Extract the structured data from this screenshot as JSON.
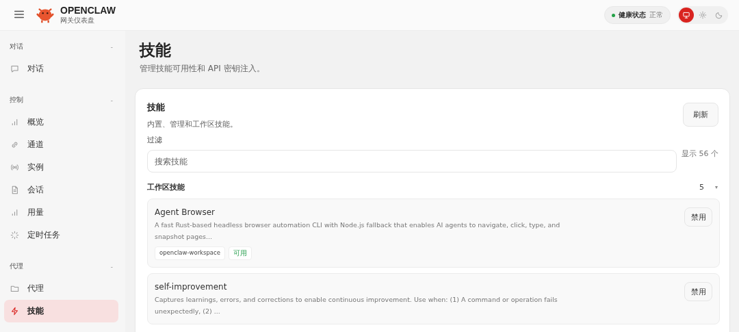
{
  "header": {
    "brand": "OPENCLAW",
    "subtitle": "网关仪表盘",
    "health": {
      "label": "健康状态",
      "value": "正常",
      "ok": true
    },
    "theme_modes": [
      {
        "kind": "system",
        "selected": true
      },
      {
        "kind": "light",
        "selected": false
      },
      {
        "kind": "dark",
        "selected": false
      }
    ]
  },
  "sidebar": {
    "sections": [
      {
        "label": "对话",
        "collapse": "-",
        "items": [
          {
            "label": "对话",
            "kind": "chat",
            "selected": false
          }
        ]
      },
      {
        "label": "控制",
        "collapse": "-",
        "items": [
          {
            "label": "概览",
            "kind": "bars",
            "selected": false
          },
          {
            "label": "通道",
            "kind": "link",
            "selected": false
          },
          {
            "label": "实例",
            "kind": "radio",
            "selected": false
          },
          {
            "label": "会话",
            "kind": "doc",
            "selected": false
          },
          {
            "label": "用量",
            "kind": "bars",
            "selected": false
          },
          {
            "label": "定时任务",
            "kind": "loader",
            "selected": false
          }
        ]
      },
      {
        "label": "代理",
        "collapse": "-",
        "items": [
          {
            "label": "代理",
            "kind": "folder",
            "selected": false
          },
          {
            "label": "技能",
            "kind": "bolt",
            "selected": true
          }
        ]
      }
    ]
  },
  "page": {
    "title": "技能",
    "subtitle": "管理技能可用性和 API 密钥注入。"
  },
  "panel": {
    "title": "技能",
    "description": "内置、管理和工作区技能。",
    "refresh_button": "刷新",
    "filter_label": "过滤",
    "search": {
      "placeholder": "搜索技能"
    },
    "count": "显示 56 个",
    "group": {
      "title": "工作区技能",
      "count": "5",
      "caret": "▾",
      "expanded": true
    },
    "skills": [
      {
        "name": "Agent Browser",
        "description": "A fast Rust-based headless browser automation CLI with Node.js fallback that enables AI agents to navigate, click, type, and snapshot pages...",
        "tags": [
          {
            "label": "openclaw-workspace",
            "kind": "source"
          },
          {
            "label": "可用",
            "kind": "status"
          }
        ],
        "button": "禁用"
      },
      {
        "name": "self-improvement",
        "description": "Captures learnings, errors, and corrections to enable continuous improvement. Use when: (1) A command or operation fails unexpectedly, (2) ...",
        "button": "禁用"
      }
    ]
  }
}
